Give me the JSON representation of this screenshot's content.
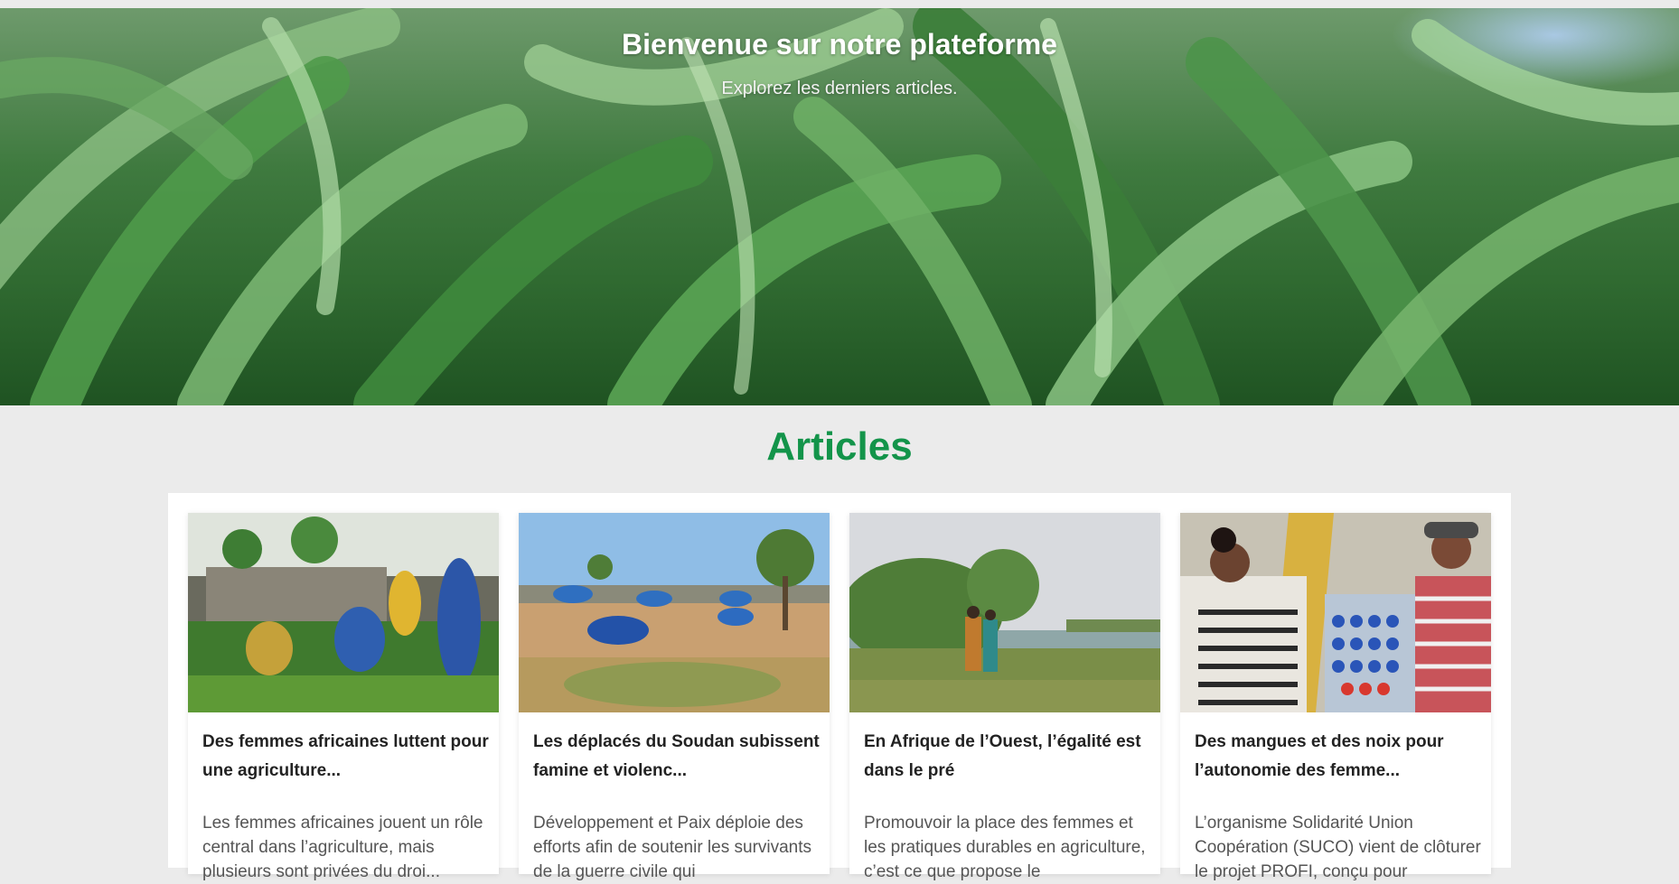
{
  "hero": {
    "title": "Bienvenue sur notre plateforme",
    "subtitle": "Explorez les derniers articles."
  },
  "articles": {
    "heading": "Articles",
    "accent_color": "#13944a",
    "items": [
      {
        "title": "Des femmes africaines luttent pour une agriculture...",
        "excerpt": "Les femmes africaines jouent un rôle central dans l’agriculture, mais plusieurs sont privées du droi...",
        "image": "women-farming-photo"
      },
      {
        "title": "Les déplacés du Soudan subissent famine et violenc...",
        "excerpt": "Développement et Paix déploie des efforts afin de soutenir les survivants de la guerre civile qui",
        "image": "displacement-camp-photo"
      },
      {
        "title": "En Afrique de l’Ouest, l’égalité est dans le pré",
        "excerpt": "Promouvoir la place des femmes et les pratiques durables en agriculture, c’est ce que propose le",
        "image": "riverbank-women-photo"
      },
      {
        "title": "Des mangues et des noix pour l’autonomie des femme...",
        "excerpt": "L’organisme Solidarité Union Coopération (SUCO) vient de clôturer le projet PROFI, conçu pour",
        "image": "market-stall-photo"
      }
    ]
  }
}
